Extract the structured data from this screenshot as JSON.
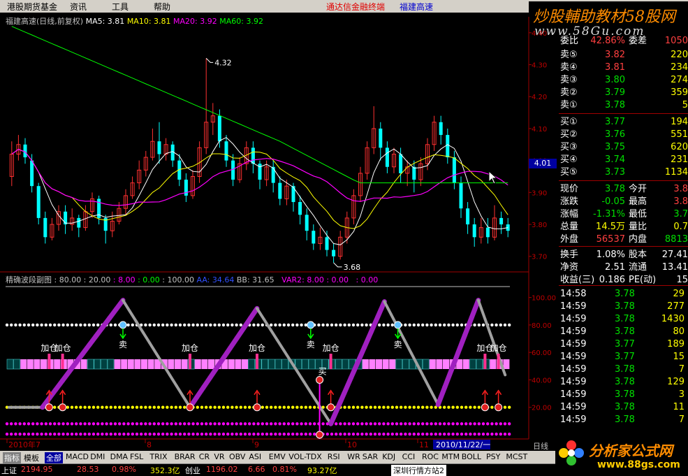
{
  "menu": {
    "items": [
      "港股期货基金",
      "资讯",
      "工具",
      "帮助"
    ],
    "link1": "通达信金融终端",
    "link2": "福建高速"
  },
  "watermark_top": {
    "line1": "炒股輔助教材58股网",
    "line2": "www.58Gu.com"
  },
  "main_header": {
    "title": "福建高速(日线,前复权)",
    "ma5": "MA5: 3.81",
    "ma10": "MA10: 3.81",
    "ma20": "MA20: 3.92",
    "ma60": "MA60: 3.92"
  },
  "sub_header": {
    "title": "精确波段副图 : 80.00 : 20.00",
    "v3": ": 8.00",
    "v4": ": 0.00",
    "v5": ": 100.00",
    "aa": "AA: 34.64",
    "bb": "BB: 31.65",
    "var2": "VAR2: 8.00 : 0.00",
    "v6": ": 0.00"
  },
  "price_axis": [
    "4.40",
    "4.30",
    "4.20",
    "4.10",
    "4.00",
    "3.90",
    "3.80",
    "3.70"
  ],
  "sub_axis": [
    "100.00",
    "80.00",
    "60.00",
    "40.00",
    "20.00"
  ],
  "annotations": {
    "high": "4.32",
    "low": "3.68",
    "add": "加仓",
    "sell": "卖",
    "buy": "买"
  },
  "date_axis": [
    "2010年7",
    "8",
    "9",
    "10",
    "11",
    "2010/11/22/一"
  ],
  "current_price_box": "4.01",
  "quote": {
    "top_partial": {
      "label": "委比",
      "value": "42.86%",
      "label2": "委差",
      "value2": "1050"
    },
    "sells": [
      {
        "label": "卖⑤",
        "price": "3.82",
        "vol": "220"
      },
      {
        "label": "卖④",
        "price": "3.81",
        "vol": "234"
      },
      {
        "label": "卖③",
        "price": "3.80",
        "vol": "274"
      },
      {
        "label": "卖②",
        "price": "3.79",
        "vol": "359"
      },
      {
        "label": "卖①",
        "price": "3.78",
        "vol": "5"
      }
    ],
    "buys": [
      {
        "label": "买①",
        "price": "3.77",
        "vol": "194"
      },
      {
        "label": "买②",
        "price": "3.76",
        "vol": "551"
      },
      {
        "label": "买③",
        "price": "3.75",
        "vol": "620"
      },
      {
        "label": "买④",
        "price": "3.74",
        "vol": "231"
      },
      {
        "label": "买⑤",
        "price": "3.73",
        "vol": "1134"
      }
    ],
    "stats": [
      {
        "l1": "现价",
        "v1": "3.78",
        "l2": "今开",
        "v2": "3.8"
      },
      {
        "l1": "涨跌",
        "v1": "-0.05",
        "l2": "最高",
        "v2": "3.8"
      },
      {
        "l1": "涨幅",
        "v1": "-1.31%",
        "l2": "最低",
        "v2": "3.7"
      },
      {
        "l1": "总量",
        "v1": "14.5万",
        "l2": "量比",
        "v2": "0.7"
      },
      {
        "l1": "外盘",
        "v1": "56537",
        "l2": "内盘",
        "v2": "8813"
      },
      {
        "l1": "换手",
        "v1": "1.08%",
        "l2": "股本",
        "v2": "27.41"
      },
      {
        "l1": "净资",
        "v1": "2.51",
        "l2": "流通",
        "v2": "13.41"
      },
      {
        "l1": "收益(三)",
        "v1": "0.186",
        "l2": "PE(动)",
        "v2": "15"
      }
    ],
    "ticks": [
      {
        "time": "14:58",
        "price": "3.78",
        "vol": "29"
      },
      {
        "time": "14:59",
        "price": "3.78",
        "vol": "277"
      },
      {
        "time": "14:59",
        "price": "3.78",
        "vol": "1430"
      },
      {
        "time": "14:59",
        "price": "3.78",
        "vol": "80"
      },
      {
        "time": "14:59",
        "price": "3.77",
        "vol": "189"
      },
      {
        "time": "14:59",
        "price": "3.77",
        "vol": "15"
      },
      {
        "time": "14:59",
        "price": "3.78",
        "vol": "7"
      },
      {
        "time": "14:59",
        "price": "3.78",
        "vol": "129"
      },
      {
        "time": "14:59",
        "price": "3.78",
        "vol": "3"
      },
      {
        "time": "14:59",
        "price": "3.78",
        "vol": "11"
      },
      {
        "time": "14:59",
        "price": "3.78",
        "vol": "7"
      }
    ]
  },
  "right_label": "日线",
  "tabs": [
    "指标",
    "模板",
    "全部",
    "MACD",
    "DMI",
    "DMA",
    "FSL",
    "TRIX",
    "BRAR",
    "CR",
    "VR",
    "OBV",
    "ASI",
    "EMV",
    "VOL-TDX",
    "RSI",
    "WR",
    "SAR",
    "KDJ",
    "CCI",
    "ROC",
    "MTM",
    "BOLL",
    "PSY",
    "MCST"
  ],
  "status": {
    "s1": "上证",
    "s2": "2194.95",
    "s3": "28.53",
    "s4": "0.98%",
    "s5": "352.3亿",
    "s6": "创业",
    "s7": "1196.02",
    "s8": "6.66",
    "s9": "0.81%",
    "s10": "93.27亿",
    "s11": "深圳行情方站2"
  },
  "watermark_bottom": {
    "line1": "分析家公式网",
    "line2": "www.88gs.com"
  },
  "colors": {
    "up": "#ff3030",
    "down": "#00ffff",
    "ma5": "#ffffff",
    "ma10": "#ffff00",
    "ma20": "#ff00ff",
    "ma60": "#00ff00"
  },
  "chart_data": {
    "type": "candlestick",
    "title": "福建高速(日线,前复权)",
    "ylim": [
      3.66,
      4.45
    ],
    "high_marker": 4.32,
    "low_marker": 3.68,
    "candles": [
      [
        3.95,
        4.02,
        3.92,
        4.06
      ],
      [
        4.02,
        4.05,
        4.0,
        4.08
      ],
      [
        4.05,
        4.01,
        3.99,
        4.07
      ],
      [
        4.0,
        3.92,
        3.9,
        4.02
      ],
      [
        3.92,
        3.82,
        3.8,
        3.93
      ],
      [
        3.82,
        3.76,
        3.74,
        3.84
      ],
      [
        3.76,
        3.8,
        3.75,
        3.82
      ],
      [
        3.8,
        3.84,
        3.78,
        3.86
      ],
      [
        3.84,
        3.8,
        3.77,
        3.86
      ],
      [
        3.8,
        3.82,
        3.78,
        3.85
      ],
      [
        3.82,
        3.79,
        3.76,
        3.83
      ],
      [
        3.79,
        3.84,
        3.78,
        3.86
      ],
      [
        3.84,
        3.88,
        3.82,
        3.9
      ],
      [
        3.88,
        3.82,
        3.8,
        3.89
      ],
      [
        3.82,
        3.78,
        3.74,
        3.83
      ],
      [
        3.78,
        3.81,
        3.76,
        3.84
      ],
      [
        3.81,
        3.85,
        3.8,
        3.87
      ],
      [
        3.85,
        3.89,
        3.83,
        3.91
      ],
      [
        3.89,
        3.93,
        3.88,
        3.95
      ],
      [
        3.93,
        3.97,
        3.91,
        4.0
      ],
      [
        3.97,
        4.01,
        3.95,
        4.03
      ],
      [
        4.01,
        4.06,
        4.0,
        4.1
      ],
      [
        4.06,
        4.02,
        3.99,
        4.12
      ],
      [
        4.02,
        4.05,
        4.0,
        4.07
      ],
      [
        4.05,
        4.0,
        3.98,
        4.06
      ],
      [
        4.0,
        3.94,
        3.92,
        4.02
      ],
      [
        3.94,
        3.89,
        3.87,
        3.96
      ],
      [
        3.89,
        3.95,
        3.88,
        3.97
      ],
      [
        3.95,
        4.04,
        3.93,
        4.06
      ],
      [
        4.04,
        4.12,
        4.02,
        4.32
      ],
      [
        4.12,
        4.14,
        4.08,
        4.18
      ],
      [
        4.14,
        4.06,
        4.04,
        4.16
      ],
      [
        4.06,
        4.0,
        3.98,
        4.08
      ],
      [
        4.0,
        3.94,
        3.92,
        4.02
      ],
      [
        3.94,
        3.99,
        3.93,
        4.01
      ],
      [
        3.99,
        4.04,
        3.97,
        4.06
      ],
      [
        4.04,
        3.99,
        3.96,
        4.06
      ],
      [
        3.99,
        3.94,
        3.91,
        4.0
      ],
      [
        3.94,
        3.98,
        3.92,
        4.0
      ],
      [
        3.98,
        3.93,
        3.9,
        4.0
      ],
      [
        3.93,
        3.88,
        3.86,
        3.95
      ],
      [
        3.88,
        3.92,
        3.86,
        3.94
      ],
      [
        3.92,
        3.87,
        3.84,
        3.93
      ],
      [
        3.87,
        3.83,
        3.8,
        3.89
      ],
      [
        3.83,
        3.78,
        3.75,
        3.85
      ],
      [
        3.78,
        3.74,
        3.72,
        3.8
      ],
      [
        3.74,
        3.76,
        3.72,
        3.79
      ],
      [
        3.76,
        3.72,
        3.7,
        3.78
      ],
      [
        3.72,
        3.7,
        3.68,
        3.74
      ],
      [
        3.7,
        3.76,
        3.69,
        3.78
      ],
      [
        3.76,
        3.82,
        3.74,
        3.84
      ],
      [
        3.82,
        3.89,
        3.8,
        3.91
      ],
      [
        3.89,
        3.96,
        3.87,
        3.98
      ],
      [
        3.96,
        4.04,
        3.94,
        4.06
      ],
      [
        4.04,
        4.1,
        4.02,
        4.17
      ],
      [
        4.1,
        4.04,
        4.0,
        4.12
      ],
      [
        4.04,
        3.98,
        3.96,
        4.06
      ],
      [
        3.98,
        4.02,
        3.96,
        4.04
      ],
      [
        4.02,
        3.96,
        3.93,
        4.04
      ],
      [
        3.96,
        3.98,
        3.92,
        4.0
      ],
      [
        3.98,
        3.94,
        3.9,
        4.0
      ],
      [
        3.94,
        3.99,
        3.92,
        4.01
      ],
      [
        3.99,
        4.05,
        3.97,
        4.07
      ],
      [
        4.05,
        4.12,
        4.03,
        4.14
      ],
      [
        4.12,
        4.08,
        4.05,
        4.14
      ],
      [
        4.08,
        4.01,
        3.99,
        4.1
      ],
      [
        4.01,
        3.93,
        3.91,
        4.03
      ],
      [
        3.93,
        3.85,
        3.82,
        3.95
      ],
      [
        3.85,
        3.8,
        3.77,
        3.87
      ],
      [
        3.8,
        3.76,
        3.73,
        3.82
      ],
      [
        3.76,
        3.79,
        3.74,
        3.82
      ],
      [
        3.79,
        3.76,
        3.74,
        3.82
      ],
      [
        3.76,
        3.82,
        3.75,
        3.86
      ],
      [
        3.82,
        3.8,
        3.77,
        3.84
      ],
      [
        3.8,
        3.78,
        3.76,
        3.82
      ]
    ]
  }
}
